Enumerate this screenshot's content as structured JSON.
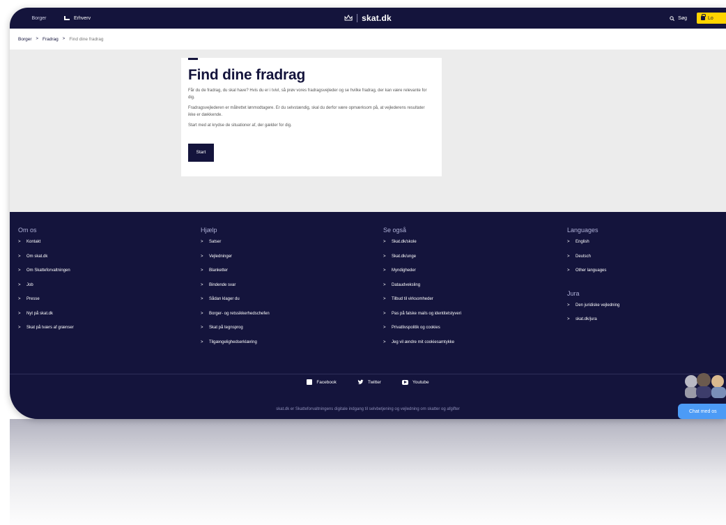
{
  "header": {
    "tabs": [
      {
        "label": "Borger",
        "active": true
      },
      {
        "label": "Erhverv",
        "active": false
      }
    ],
    "logo_text": "skat.dk",
    "search_label": "Søg",
    "login_label": "Lo"
  },
  "breadcrumb": [
    "Borger",
    "Fradrag",
    "Find dine fradrag"
  ],
  "card": {
    "title": "Find dine fradrag",
    "paragraphs": [
      "Får du de fradrag, du skal have? Hvis du er i tvivl, så prøv vores fradragsvejleder og se hvilke fradrag, der kan være relevante for dig.",
      "Fradragsvejlederen er målrettet lønmodtagere. Er du selvstændig, skal du derfor være opmærksom på, at vejlederens resultater ikke er dækkende.",
      "Start med at krydse de situationer af, der gælder for dig."
    ],
    "start_label": "Start"
  },
  "footer": {
    "columns": [
      {
        "title": "Om os",
        "items": [
          "Kontakt",
          "Om skat.dk",
          "Om Skatteforvaltningen",
          "Job",
          "Presse",
          "Nyt på skat.dk",
          "Skat på tværs af grænser"
        ]
      },
      {
        "title": "Hjælp",
        "items": [
          "Satser",
          "Vejledninger",
          "Blanketter",
          "Bindende svar",
          "Sådan klager du",
          "Borger- og retssikkerhedschefen",
          "Skat på tegnsprog",
          "Tilgængelighedserklæring"
        ]
      },
      {
        "title": "Se også",
        "items": [
          "Skat.dk/skole",
          "Skat.dk/unge",
          "Myndigheder",
          "Dataudveksling",
          "Tilbud til virksomheder",
          "Pas på falske mails og identitetstyveri",
          "Privatlivspolitik og cookies",
          "Jeg vil ændre mit cookiesamtykke"
        ]
      },
      {
        "title": "Languages",
        "items": [
          "English",
          "Deutsch",
          "Other languages"
        ]
      },
      {
        "title": "Jura",
        "items": [
          "Den juridiske vejledning",
          "skat.dk/jura"
        ]
      }
    ],
    "social": [
      "Facebook",
      "Twitter",
      "Youtube"
    ],
    "tagline": "skat.dk er Skatteforvaltningens digitale indgang til selvbetjening og vejledning om skatter og afgifter"
  },
  "chat": {
    "label": "Chat med os"
  },
  "colors": {
    "navy": "#14143c",
    "accent_yellow": "#ffd400",
    "chat_blue": "#4c9bf6",
    "page_bg": "#ececec"
  }
}
